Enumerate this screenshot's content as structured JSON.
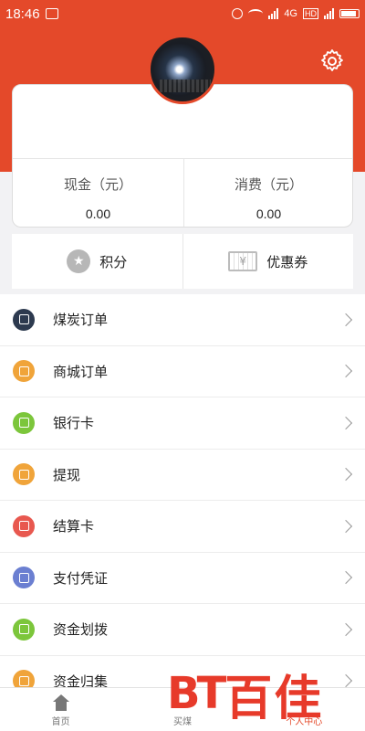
{
  "status_bar": {
    "time": "18:46",
    "network": "4G",
    "hd": "HD"
  },
  "stats": [
    {
      "label": "现金（元）",
      "value": "0.00"
    },
    {
      "label": "消费（元）",
      "value": "0.00"
    }
  ],
  "quick_actions": {
    "points_label": "积分",
    "coupon_label": "优惠券",
    "coupon_glyph": "¥"
  },
  "menu": [
    {
      "label": "煤炭订单",
      "icon": "coal-order-icon",
      "color": "#2d3a4f"
    },
    {
      "label": "商城订单",
      "icon": "mall-order-icon",
      "color": "#f0a43a"
    },
    {
      "label": "银行卡",
      "icon": "bank-card-icon",
      "color": "#7cc63b"
    },
    {
      "label": "提现",
      "icon": "withdraw-icon",
      "color": "#f0a43a"
    },
    {
      "label": "结算卡",
      "icon": "settlement-card-icon",
      "color": "#e8584f"
    },
    {
      "label": "支付凭证",
      "icon": "payment-voucher-icon",
      "color": "#6b7fd1"
    },
    {
      "label": "资金划拨",
      "icon": "fund-transfer-icon",
      "color": "#7cc63b"
    },
    {
      "label": "资金归集",
      "icon": "fund-collection-icon",
      "color": "#f0a43a"
    }
  ],
  "tabs": [
    {
      "label": "首页"
    },
    {
      "label": "买煤"
    },
    {
      "label": "个人中心"
    }
  ],
  "watermark": {
    "logo": "BT",
    "name": "百佳"
  },
  "colors": {
    "brand": "#e4492a",
    "background": "#f2f2f4"
  }
}
